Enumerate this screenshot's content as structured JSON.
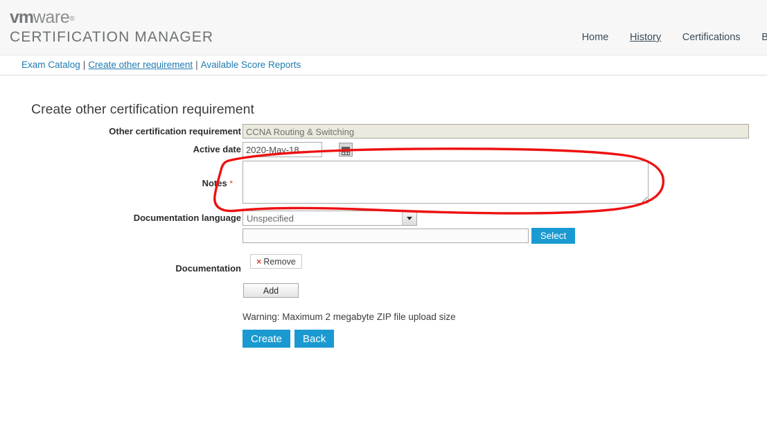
{
  "header": {
    "brand_vm": "vm",
    "brand_ware": "ware",
    "brand_reg": "®",
    "product_name": "CERTIFICATION MANAGER",
    "nav": [
      {
        "label": "Home",
        "active": false
      },
      {
        "label": "History",
        "active": true
      },
      {
        "label": "Certifications",
        "active": false
      },
      {
        "label": "Ben",
        "active": false
      }
    ]
  },
  "breadcrumb": {
    "items": [
      {
        "label": "Exam Catalog",
        "active": false
      },
      {
        "label": "Create other requirement",
        "active": true
      },
      {
        "label": "Available Score Reports",
        "active": false
      }
    ],
    "separator": "|"
  },
  "main": {
    "page_title": "Create other certification requirement",
    "fields": {
      "requirement": {
        "label": "Other certification requirement",
        "value": "CCNA Routing & Switching",
        "disabled": true
      },
      "active_date": {
        "label": "Active date",
        "value": "2020-May-18",
        "placeholder": ""
      },
      "calendar_icon": "calendar-icon",
      "notes": {
        "label": "Notes",
        "required_marker": "*",
        "value": "",
        "placeholder": ""
      },
      "doc_language": {
        "label": "Documentation language",
        "selected": "Unspecified",
        "options": [
          "Unspecified"
        ]
      },
      "doc_path": {
        "value": "",
        "placeholder": ""
      },
      "documentation": {
        "label": "Documentation"
      }
    },
    "buttons": {
      "select": "Select",
      "remove": "Remove",
      "remove_icon": "×",
      "add": "Add",
      "create": "Create",
      "back": "Back"
    },
    "warning_text": "Warning: Maximum 2 megabyte ZIP file upload size"
  },
  "annotation": {
    "type": "freehand-ellipse",
    "color": "#ee1111",
    "stroke_width": 3,
    "target": "notes-field",
    "description": "hand-drawn red circle around the Notes textarea"
  },
  "colors": {
    "accent_blue": "#1a9ad1",
    "header_bg": "#f7f7f7",
    "link_blue": "#1f7bb0",
    "disabled_field_bg": "#eceadf",
    "required_red": "#e23b2e",
    "annotation_red": "#ee1111"
  }
}
